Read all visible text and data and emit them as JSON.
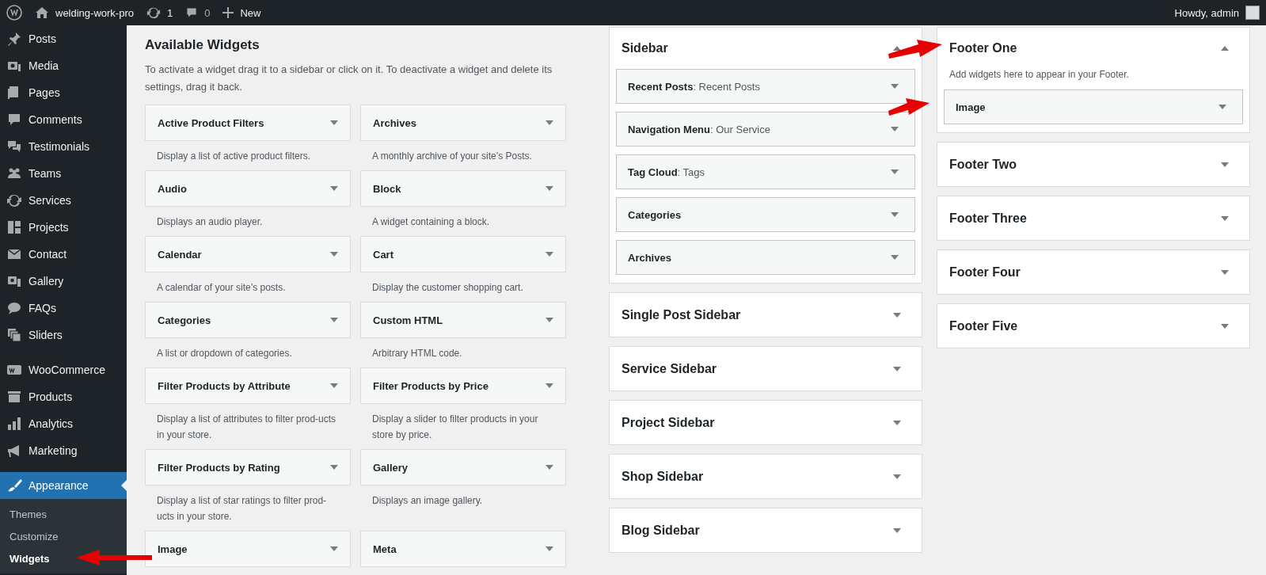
{
  "admin_bar": {
    "site_name": "welding-work-pro",
    "updates": "1",
    "comments": "0",
    "new_label": "New",
    "greeting": "Howdy, admin"
  },
  "menu": {
    "groups": [
      [
        {
          "label": "Posts",
          "selected": false
        },
        {
          "label": "Media",
          "selected": false
        },
        {
          "label": "Pages",
          "selected": false
        },
        {
          "label": "Comments",
          "selected": false
        },
        {
          "label": "Testimonials",
          "selected": false
        },
        {
          "label": "Teams",
          "selected": false
        },
        {
          "label": "Services",
          "selected": false
        },
        {
          "label": "Projects",
          "selected": false
        },
        {
          "label": "Contact",
          "selected": false
        },
        {
          "label": "Gallery",
          "selected": false
        },
        {
          "label": "FAQs",
          "selected": false
        },
        {
          "label": "Sliders",
          "selected": false
        }
      ],
      [
        {
          "label": "WooCommerce",
          "selected": false
        },
        {
          "label": "Products",
          "selected": false
        },
        {
          "label": "Analytics",
          "selected": false
        },
        {
          "label": "Marketing",
          "selected": false
        }
      ],
      [
        {
          "label": "Appearance",
          "selected": true
        }
      ]
    ],
    "submenu": [
      {
        "label": "Themes",
        "selected": false
      },
      {
        "label": "Customize",
        "selected": false
      },
      {
        "label": "Widgets",
        "selected": true
      }
    ]
  },
  "available_widgets": {
    "title": "Available Widgets",
    "description": "To activate a widget drag it to a sidebar or click on it. To deactivate a widget and delete its settings, drag it back.",
    "widgets": [
      {
        "title": "Active Product Filters",
        "description": "Display a list of active product filters."
      },
      {
        "title": "Archives",
        "description": "A monthly archive of your site’s Posts."
      },
      {
        "title": "Audio",
        "description": "Displays an audio player."
      },
      {
        "title": "Block",
        "description": "A widget containing a block."
      },
      {
        "title": "Calendar",
        "description": "A calendar of your site’s posts."
      },
      {
        "title": "Cart",
        "description": "Display the customer shopping cart."
      },
      {
        "title": "Categories",
        "description": "A list or dropdown of categories."
      },
      {
        "title": "Custom HTML",
        "description": "Arbitrary HTML code."
      },
      {
        "title": "Filter Products by Attribute",
        "description": "Display a list of attributes to filter prod-ucts in your store."
      },
      {
        "title": "Filter Products by Price",
        "description": "Display a slider to filter products in your store by price."
      },
      {
        "title": "Filter Products by Rating",
        "description": "Display a list of star ratings to filter prod-ucts in your store."
      },
      {
        "title": "Gallery",
        "description": "Displays an image gallery."
      },
      {
        "title": "Image"
      },
      {
        "title": "Meta"
      }
    ]
  },
  "sidebar_columns": [
    [
      {
        "title": "Sidebar",
        "expanded": true,
        "widgets": [
          {
            "title": "Recent Posts",
            "subtitle": ": Recent Posts"
          },
          {
            "title": "Navigation Menu",
            "subtitle": ": Our Service"
          },
          {
            "title": "Tag Cloud",
            "subtitle": ": Tags"
          },
          {
            "title": "Categories"
          },
          {
            "title": "Archives"
          }
        ]
      },
      {
        "title": "Single Post Sidebar",
        "expanded": false
      },
      {
        "title": "Service Sidebar",
        "expanded": false
      },
      {
        "title": "Project Sidebar",
        "expanded": false
      },
      {
        "title": "Shop Sidebar",
        "expanded": false
      },
      {
        "title": "Blog Sidebar",
        "expanded": false
      }
    ],
    [
      {
        "title": "Footer One",
        "expanded": true,
        "description": "Add widgets here to appear in your Footer.",
        "widgets": [
          {
            "title": "Image"
          }
        ]
      },
      {
        "title": "Footer Two",
        "expanded": false
      },
      {
        "title": "Footer Three",
        "expanded": false
      },
      {
        "title": "Footer Four",
        "expanded": false
      },
      {
        "title": "Footer Five",
        "expanded": false
      }
    ]
  ]
}
